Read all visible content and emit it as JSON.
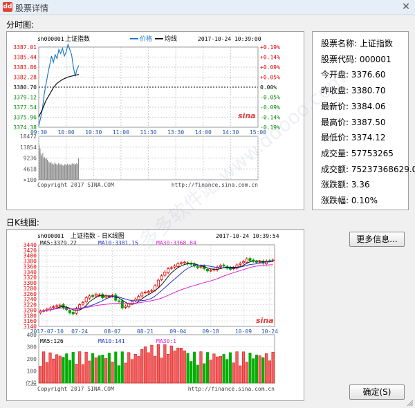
{
  "window": {
    "title": "股票详情",
    "icon_text": "dd"
  },
  "sections": {
    "intraday": "分时图:",
    "kline": "日K线图:"
  },
  "intraday": {
    "code": "sh000001",
    "name": "上证指数",
    "legend_price": "价格",
    "legend_avg": "均线",
    "datetime": "2017-10-24 10:39:00",
    "y_labels": [
      "3387.01",
      "3385.44",
      "3383.86",
      "3382.28",
      "3380.70",
      "3379.12",
      "3377.54",
      "3375.96",
      "3374.38"
    ],
    "pct_labels": [
      "+0.19%",
      "+0.14%",
      "+0.09%",
      "+0.05%",
      "0.00%",
      "-0.05%",
      "-0.09%",
      "-0.14%",
      "-0.19%"
    ],
    "x_labels": [
      "09:30",
      "10:00",
      "10:30",
      "11:00",
      "11:30",
      "13:30",
      "14:00",
      "14:30",
      "15:00"
    ],
    "vol_labels": [
      "18472",
      "13854",
      "9236",
      "4618",
      "×100"
    ],
    "copyright": "Copyright 2017 SINA.COM",
    "url": "http://finance.sina.com.cn",
    "sina": "sina",
    "colors": {
      "price": "#1f7bc8",
      "avg": "#111111",
      "up": "#e00000",
      "down": "#008800"
    }
  },
  "info": [
    {
      "label": "股票名称:",
      "value": "上证指数"
    },
    {
      "label": "股票代码:",
      "value": "000001"
    },
    {
      "label": "今开盘:",
      "value": "3376.60"
    },
    {
      "label": "昨收盘:",
      "value": "3380.70"
    },
    {
      "label": "最新价:",
      "value": "3384.06"
    },
    {
      "label": "最高价:",
      "value": "3387.50"
    },
    {
      "label": "最低价:",
      "value": "3374.12"
    },
    {
      "label": "成交量:",
      "value": "57753265"
    },
    {
      "label": "成交额:",
      "value": "75237368629.00"
    },
    {
      "label": "涨跌额:",
      "value": "3.36"
    },
    {
      "label": "涨跌幅:",
      "value": "0.10%"
    }
  ],
  "kline": {
    "code": "sh000001",
    "title": "上证指数 - 日K线图",
    "datetime": "2017-10-24 10:39:54",
    "ma5": "MA5:3379.22",
    "ma10": "MA10:3381.15",
    "ma30": "MA30:3368.84",
    "y_labels": [
      "3440",
      "3420",
      "3400",
      "3380",
      "3360",
      "3340",
      "3320",
      "3300",
      "3280",
      "3260",
      "3240",
      "3220",
      "3200",
      "3180",
      "3160",
      "3140"
    ],
    "x_labels": [
      "2017-07-10",
      "07-24",
      "08-07",
      "08-21",
      "09-04",
      "09-18",
      "10-09",
      "10-24"
    ],
    "vol_labels": [
      "400",
      "300",
      "200",
      "100",
      "亿股"
    ],
    "vma5": "MA5:126",
    "vma10": "MA10:141",
    "vma30": "MA30:1",
    "copyright": "Copyright 2017 SINA.COM",
    "url": "http://finance.sina.com.cn",
    "sina": "sina",
    "colors": {
      "ma5": "#111111",
      "ma10": "#2233cc",
      "ma30": "#e020d0",
      "up": "#e00000",
      "down": "#00a000"
    }
  },
  "buttons": {
    "more": "更多信息...",
    "ok": "确定(S)"
  },
  "watermark": "多多软件站  www.ddooo.com"
}
